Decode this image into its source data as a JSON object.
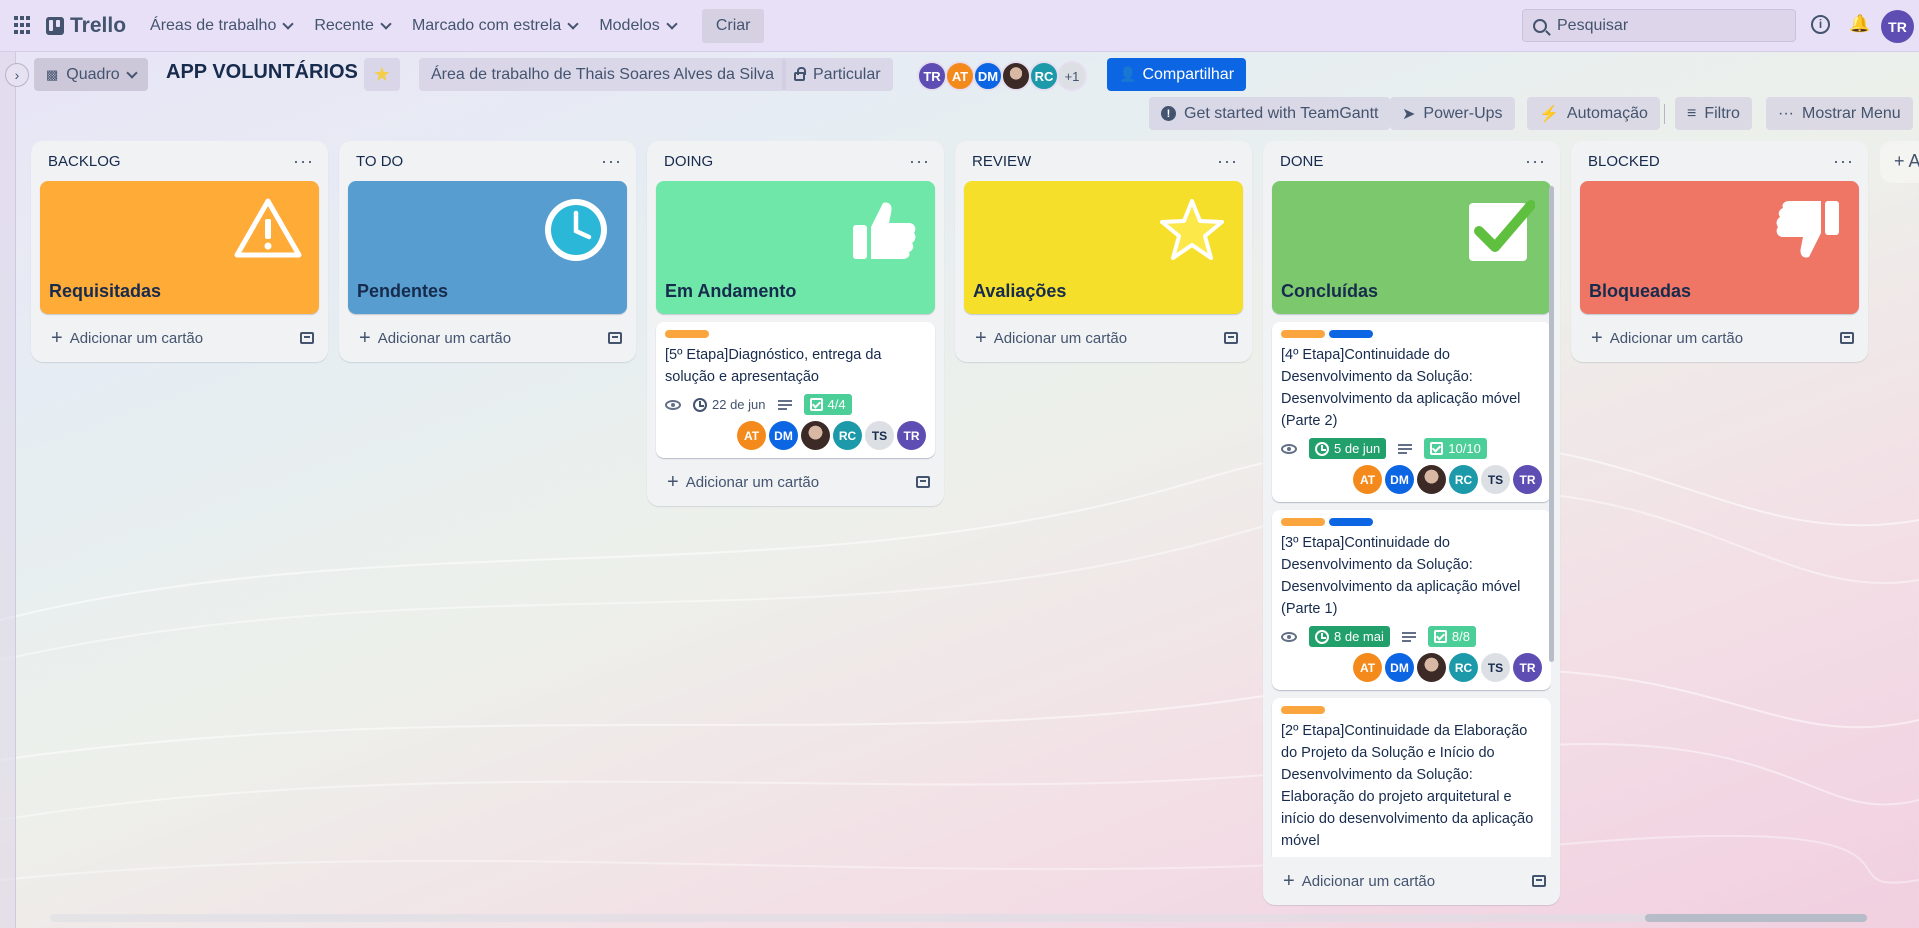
{
  "topbar": {
    "brand": "Trello",
    "nav": [
      "Áreas de trabalho",
      "Recente",
      "Marcado com estrela",
      "Modelos"
    ],
    "create": "Criar",
    "search_placeholder": "Pesquisar",
    "user_initials": "TR"
  },
  "board": {
    "view": "Quadro",
    "title": "APP VOLUNTÁRIOS",
    "workspace": "Área de trabalho de Thais Soares Alves da Silva",
    "visibility": "Particular",
    "members": [
      "TR",
      "AT",
      "DM",
      "",
      "RC"
    ],
    "members_more": "+1",
    "share": "Compartilhar",
    "actions": {
      "teamgantt": "Get started with TeamGantt",
      "powerups": "Power-Ups",
      "automation": "Automação",
      "filter": "Filtro",
      "menu": "Mostrar Menu"
    }
  },
  "colors": {
    "backlog": "#ffab38",
    "todo": "#579dd0",
    "doing": "#6ee7a8",
    "review": "#f5df2b",
    "done": "#7cc96d",
    "blocked": "#ef7565",
    "label_orange": "#faa53d",
    "label_blue": "#0c66e4"
  },
  "add_card": "Adicionar um cartão",
  "lists": [
    {
      "title": "BACKLOG",
      "cover": "Requisitadas",
      "icon": "warning-icon"
    },
    {
      "title": "TO DO",
      "cover": "Pendentes",
      "icon": "clock-icon"
    },
    {
      "title": "DOING",
      "cover": "Em Andamento",
      "icon": "thumbs-up-icon"
    },
    {
      "title": "REVIEW",
      "cover": "Avaliações",
      "icon": "star-icon"
    },
    {
      "title": "DONE",
      "cover": "Concluídas",
      "icon": "checkmark-icon"
    },
    {
      "title": "BLOCKED",
      "cover": "Bloqueadas",
      "icon": "thumbs-down-icon"
    }
  ],
  "cards": {
    "doing_1": {
      "title": "[5º Etapa]Diagnóstico, entrega da solução e apresentação",
      "due": "22 de jun",
      "checklist": "4/4",
      "members": [
        "AT",
        "DM",
        "",
        "RC",
        "TS",
        "TR"
      ]
    },
    "done_1": {
      "title": "[4º Etapa]Continuidade do Desenvolvimento da Solução: Desenvolvimento da aplicação móvel (Parte 2)",
      "due": "5 de jun",
      "checklist": "10/10",
      "members": [
        "AT",
        "DM",
        "",
        "RC",
        "TS",
        "TR"
      ]
    },
    "done_2": {
      "title": "[3º Etapa]Continuidade do Desenvolvimento da Solução: Desenvolvimento da aplicação móvel (Parte 1)",
      "due": "8 de mai",
      "checklist": "8/8",
      "members": [
        "AT",
        "DM",
        "",
        "RC",
        "TS",
        "TR"
      ]
    },
    "done_3": {
      "title": "[2º Etapa]Continuidade da Elaboração do Projeto da Solução e Início do Desenvolvimento da Solução: Elaboração do projeto arquitetural e início do desenvolvimento da aplicação móvel"
    }
  },
  "add_list": "+ A"
}
